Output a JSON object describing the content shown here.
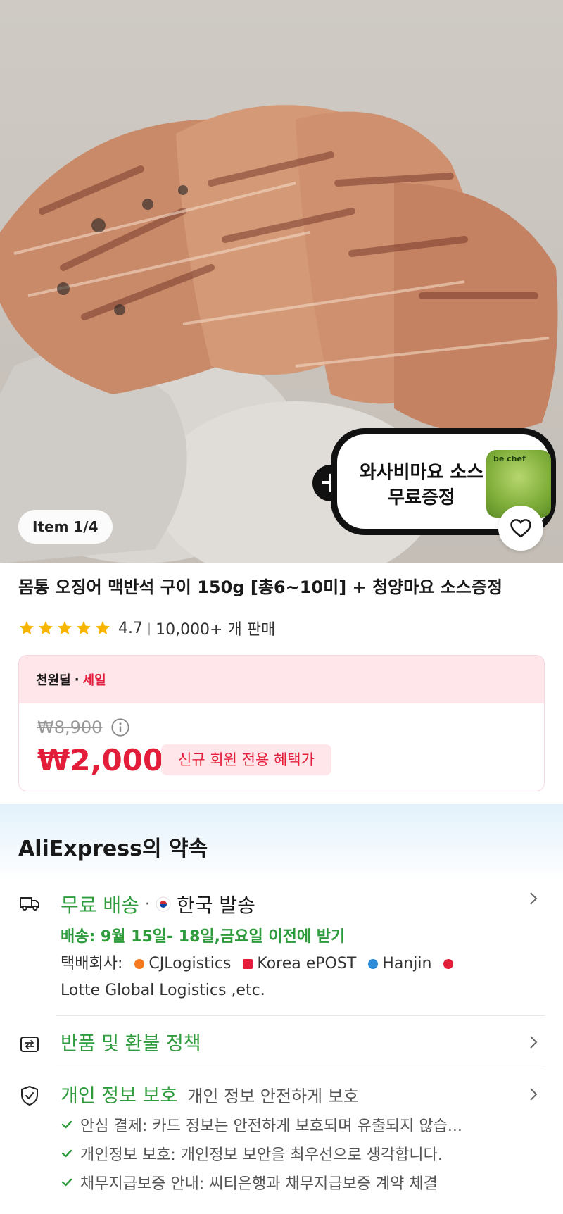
{
  "hero": {
    "promo_line1": "와사비마요 소스",
    "promo_line2": "무료증정",
    "sauce_brand": "be chef",
    "pager": "Item 1/4",
    "favorite_icon": "heart-outline-icon"
  },
  "product": {
    "title": "몸통 오징어 맥반석 구이 150g [총6~10미] + 청양마요 소스증정",
    "rating": "4.7",
    "sold": "10,000+ 개 판매",
    "star_count": 5
  },
  "deal": {
    "label": "천원딜",
    "sale": "세일",
    "original_price": "₩8,900",
    "price": "₩2,000",
    "badge": "신규 회원 전용 혜택가",
    "accent_color": "#e31e3b"
  },
  "promise": {
    "title": "AliExpress의 약속",
    "shipping": {
      "label": "무료 배송",
      "origin": "한국 발송",
      "delivery": "배송: 9월 15일- 18일,금요일 이전에 받기",
      "courier_prefix": "택배회사:",
      "couriers": [
        "CJLogistics",
        "Korea ePOST",
        "Hanjin",
        "Lotte Global Logistics ,etc."
      ]
    },
    "returns": {
      "label": "반품 및 환불 정책"
    },
    "privacy": {
      "label": "개인 정보 보호",
      "sub": "개인 정보 안전하게 보호",
      "checks": [
        "안심 결제: 카드 정보는 안전하게 보호되며 유출되지 않습...",
        "개인정보 보호: 개인정보 보안을 최우선으로 생각합니다.",
        "채무지급보증 안내: 씨티은행과 채무지급보증 계약 체결"
      ]
    },
    "accent_green": "#2e9b3c"
  }
}
